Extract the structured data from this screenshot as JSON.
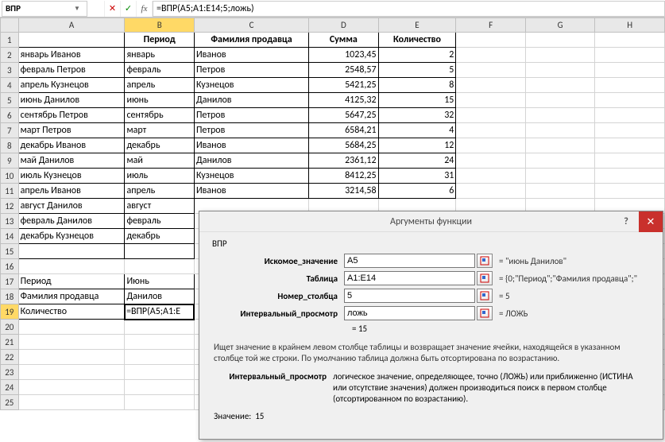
{
  "formula_bar": {
    "name_box": "ВПР",
    "fx_label": "fx",
    "formula": "=ВПР(A5;A1:E14;5;ложь)"
  },
  "columns": [
    "A",
    "B",
    "C",
    "D",
    "E",
    "F",
    "G",
    "H"
  ],
  "headers": {
    "a": "",
    "b": "Период",
    "c": "Фамилия продавца",
    "d": "Сумма",
    "e": "Количество"
  },
  "rows": [
    {
      "a": "январь Иванов",
      "b": "январь",
      "c": "Иванов",
      "d": "1023,45",
      "e": "2"
    },
    {
      "a": "февраль Петров",
      "b": "февраль",
      "c": "Петров",
      "d": "2548,57",
      "e": "5"
    },
    {
      "a": "апрель Кузнецов",
      "b": "апрель",
      "c": "Кузнецов",
      "d": "5421,25",
      "e": "8"
    },
    {
      "a": "июнь Данилов",
      "b": "июнь",
      "c": "Данилов",
      "d": "4125,32",
      "e": "15"
    },
    {
      "a": "сентябрь Петров",
      "b": "сентябрь",
      "c": "Петров",
      "d": "5647,25",
      "e": "32"
    },
    {
      "a": "март Петров",
      "b": "март",
      "c": "Петров",
      "d": "6584,21",
      "e": "4"
    },
    {
      "a": "декабрь Иванов",
      "b": "декабрь",
      "c": "Иванов",
      "d": "5684,25",
      "e": "12"
    },
    {
      "a": "май Данилов",
      "b": "май",
      "c": "Данилов",
      "d": "2361,12",
      "e": "24"
    },
    {
      "a": "июль Кузнецов",
      "b": "июль",
      "c": "Кузнецов",
      "d": "8412,25",
      "e": "31"
    },
    {
      "a": "апрель Иванов",
      "b": "апрель",
      "c": "Иванов",
      "d": "3214,58",
      "e": "6"
    },
    {
      "a": "август Данилов",
      "b": "август",
      "c": "",
      "d": "",
      "e": ""
    },
    {
      "a": "февраль Данилов",
      "b": "февраль",
      "c": "",
      "d": "",
      "e": ""
    },
    {
      "a": "декабрь Кузнецов",
      "b": "декабрь",
      "c": "",
      "d": "",
      "e": ""
    }
  ],
  "lookup": {
    "r17a": "Период",
    "r17b": "Июнь",
    "r18a": "Фамилия продавца",
    "r18b": "Данилов",
    "r19a": "Количество",
    "r19b": "=ВПР(A5;A1:E"
  },
  "dialog": {
    "title": "Аргументы функции",
    "func": "ВПР",
    "args": [
      {
        "label": "Искомое_значение",
        "value": "A5",
        "result": "=  \"июнь Данилов\""
      },
      {
        "label": "Таблица",
        "value": "A1:E14",
        "result": "=  {0;\"Период\";\"Фамилия продавца\";\""
      },
      {
        "label": "Номер_столбца",
        "value": "5",
        "result": "=  5"
      },
      {
        "label": "Интервальный_просмотр",
        "value": "ложь",
        "result": "=  ЛОЖЬ"
      }
    ],
    "overall_result": "=  15",
    "desc": "Ищет значение в крайнем левом столбце таблицы и возвращает значение ячейки, находящейся в указанном столбце той же строки. По умолчанию таблица должна быть отсортирована по возрастанию.",
    "arg_desc_label": "Интервальный_просмотр",
    "arg_desc_text": "логическое значение, определяющее, точно (ЛОЖЬ) или приближенно (ИСТИНА или отсутствие значения) должен производиться поиск в первом столбце (отсортированном по возрастанию).",
    "value_label": "Значение:",
    "value": "15"
  }
}
